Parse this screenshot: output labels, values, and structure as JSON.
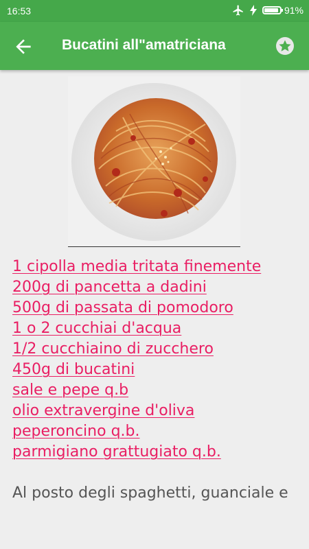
{
  "status_bar": {
    "time": "16:53",
    "battery": "91%",
    "battery_level": 0.91,
    "icons": [
      "airplane-icon",
      "charging-icon",
      "battery-icon"
    ]
  },
  "toolbar": {
    "title": "Bucatini all\"amatricianа",
    "back_icon": "arrow-back-icon",
    "favorite_icon": "star-icon"
  },
  "recipe": {
    "image": "spaghetti-photo",
    "ingredients": [
      "1 cipolla media tritata finemente",
      "200g di pancetta a dadini",
      "500g di passata di pomodoro",
      "1 o 2 cucchiai d'acqua",
      "1/2 cucchiaino di zucchero",
      "450g di bucatini",
      "sale e pepe q.b",
      "olio extravergine d'oliva",
      "peperoncino q.b.",
      "parmigiano grattugiato q.b."
    ],
    "note": "Al posto degli spaghetti, guanciale e"
  },
  "colors": {
    "status_bar": "#45a84a",
    "toolbar": "#4caf50",
    "link": "#e91e63",
    "background": "#eeeeee"
  }
}
